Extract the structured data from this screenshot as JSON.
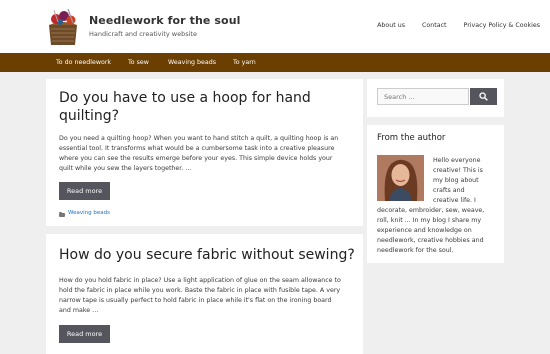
{
  "site": {
    "title": "Needlework for the soul",
    "tagline": "Handicraft and creativity website"
  },
  "top_nav": [
    "About us",
    "Contact",
    "Privacy Policy & Cookies"
  ],
  "main_nav": [
    "To do needlework",
    "To sew",
    "Weaving beads",
    "To yarn"
  ],
  "posts": [
    {
      "title_line1": "Do you have to use a hoop for hand",
      "title_line2": "quilting?",
      "excerpt": [
        "Do you need a quilting hoop? When you want to hand stitch a quilt, a quilting hoop is an",
        "essential tool. It transforms what would be a cumbersome task into a creative pleasure",
        "where you can see the results emerge before your eyes. This simple device holds your",
        "quilt while you sew the layers together. …"
      ],
      "read_more": "Read more",
      "category": "Weaving beads"
    },
    {
      "title_line1": "How do you secure fabric without sewing?",
      "excerpt": [
        "How do you hold fabric in place? Use a light application of glue on the seam allowance to",
        "hold the fabric in place while you work. Baste the fabric in place with fusible tape. A very",
        "narrow tape is usually perfect to hold fabric in place while it's flat on the ironing board",
        "and make …"
      ],
      "read_more": "Read more"
    }
  ],
  "search": {
    "placeholder": "Search …"
  },
  "author_widget": {
    "title": "From the author",
    "side_lines": [
      "Hello everyone",
      "creative! This is",
      "my blog about",
      "crafts and",
      "creative life. I"
    ],
    "full_lines": [
      "decorate, embroider, sew, weave,",
      "roll, knit ... In my blog I share my",
      "experience and knowledge on",
      "needlework, creative hobbies and",
      "needlework for the soul."
    ]
  },
  "colors": {
    "nav_bg": "#6b3f02",
    "button": "#55555e",
    "link": "#1e73be"
  }
}
